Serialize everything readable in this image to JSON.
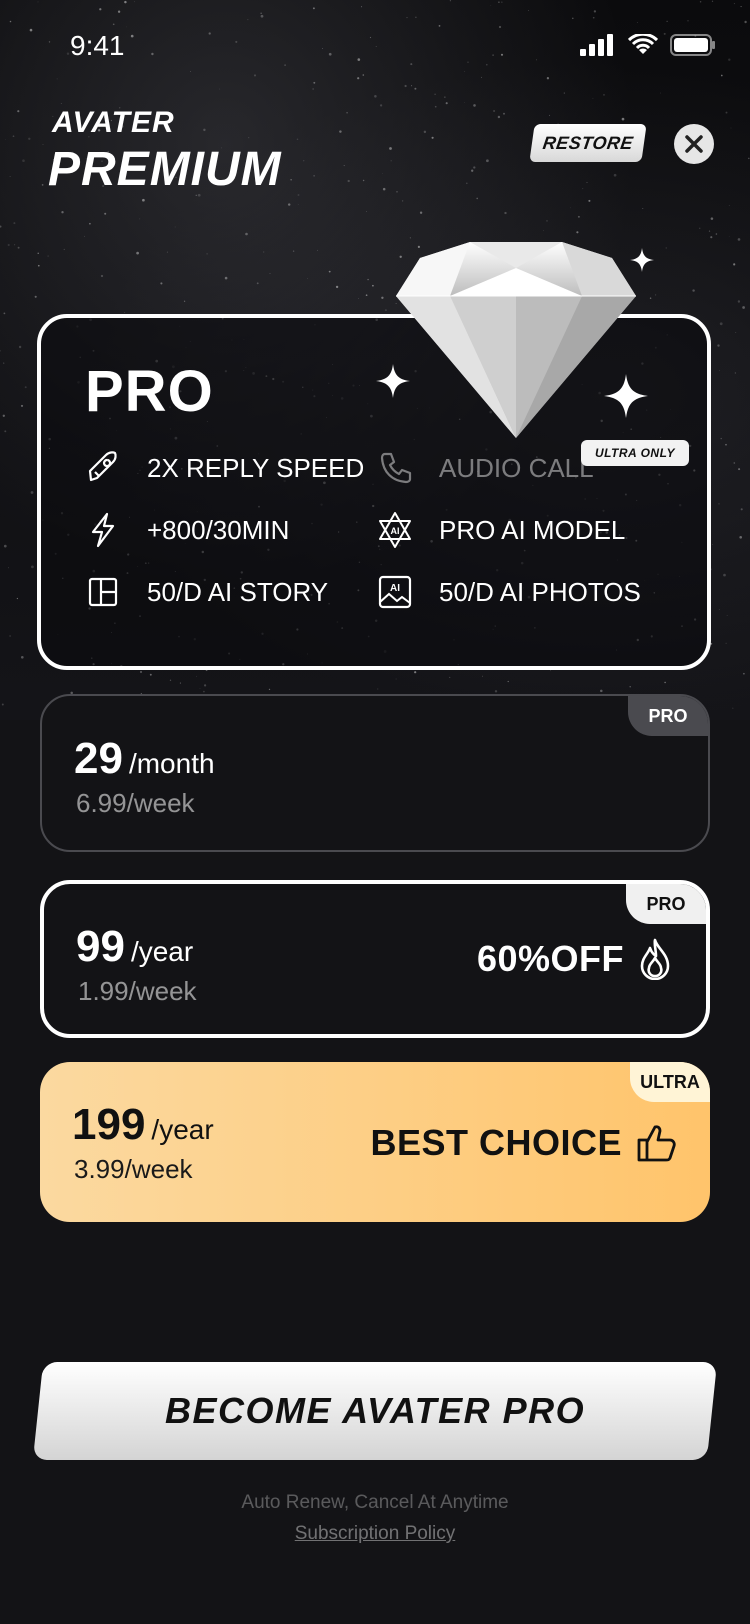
{
  "status_bar": {
    "time": "9:41"
  },
  "header": {
    "brand": "AVATER",
    "title": "PREMIUM",
    "restore_label": "RESTORE"
  },
  "pro_card": {
    "title": "PRO",
    "ultra_only_label": "ULTRA ONLY",
    "features": [
      {
        "label": "2X REPLY SPEED",
        "icon": "rocket-icon",
        "dim": false
      },
      {
        "label": "AUDIO CALL",
        "icon": "phone-icon",
        "dim": true
      },
      {
        "label": "+800/30MIN",
        "icon": "lightning-icon",
        "dim": false
      },
      {
        "label": "PRO AI MODEL",
        "icon": "ai-star-icon",
        "dim": false
      },
      {
        "label": "50/D AI STORY",
        "icon": "story-icon",
        "dim": false
      },
      {
        "label": "50/D AI PHOTOS",
        "icon": "ai-photo-icon",
        "dim": false
      }
    ]
  },
  "plans": [
    {
      "badge": "PRO",
      "price": "29",
      "period": "/month",
      "weekly": "6.99/week",
      "tag": ""
    },
    {
      "badge": "PRO",
      "price": "99",
      "period": "/year",
      "weekly": "1.99/week",
      "tag": "60%OFF",
      "tag_icon": "flame-icon"
    },
    {
      "badge": "ULTRA",
      "price": "199",
      "period": "/year",
      "weekly": "3.99/week",
      "tag": "BEST CHOICE",
      "tag_icon": "thumbs-up-icon"
    }
  ],
  "cta": {
    "label": "BECOME AVATER PRO"
  },
  "footer": {
    "note": "Auto Renew, Cancel At Anytime",
    "policy_link": "Subscription Policy"
  },
  "colors": {
    "background": "#131316",
    "ultra_gradient_start": "#fbd9a0",
    "ultra_gradient_end": "#ffc46b",
    "accent_white": "#ffffff"
  }
}
